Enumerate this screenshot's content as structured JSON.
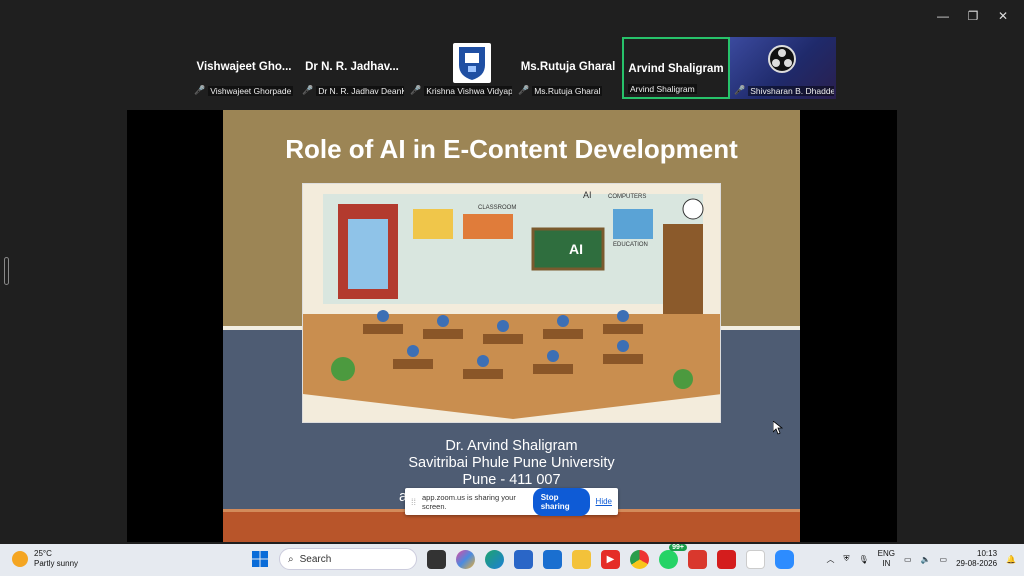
{
  "window_controls": {
    "minimize": "—",
    "restore": "❐",
    "close": "✕"
  },
  "participants": [
    {
      "name": "Vishwajeet  Gho...",
      "label": "Vishwajeet Ghorpade",
      "muted": true,
      "active": false
    },
    {
      "name": "Dr N. R. Jadhav...",
      "label": "Dr N. R. Jadhav DeanKIP",
      "muted": true,
      "active": false
    },
    {
      "name": "",
      "label": "Krishna Vishwa Vidyap...",
      "muted": true,
      "active": false,
      "logo": "kvv-logo"
    },
    {
      "name": "Ms.Rutuja Gharal",
      "label": "Ms.Rutuja Gharal",
      "muted": true,
      "active": false
    },
    {
      "name": "Arvind Shaligram",
      "label": "Arvind Shaligram",
      "muted": false,
      "active": true
    },
    {
      "name": "",
      "label": "Shivsharan B. Dhadde",
      "muted": true,
      "active": false,
      "logo": "obs-logo"
    }
  ],
  "slide": {
    "title": "Role of AI in E-Content Development",
    "author_line1": "Dr. Arvind Shaligram",
    "author_line2": "Savitribai Phule Pune University",
    "author_line3": "Pune - 411 007",
    "author_line4": "a",
    "illustration_labels": [
      "CLASSROOM",
      "AI",
      "COMPUTERS",
      "EDUCATION",
      "AI"
    ]
  },
  "share_toast": {
    "message": "app.zoom.us is sharing your screen.",
    "stop_label": "Stop sharing",
    "hide_label": "Hide"
  },
  "taskbar": {
    "weather_temp": "25°C",
    "weather_desc": "Partly sunny",
    "search_placeholder": "Search",
    "whatsapp_badge": "99+",
    "lang_line1": "ENG",
    "lang_line2": "IN",
    "time": "10:13",
    "date": "29-08-2026"
  },
  "colors": {
    "active_speaker_border": "#27c26a",
    "stop_button": "#0e5bd6",
    "slide_top": "#9c8555",
    "slide_body": "#4e5c73",
    "slide_footer": "#b8552a"
  }
}
